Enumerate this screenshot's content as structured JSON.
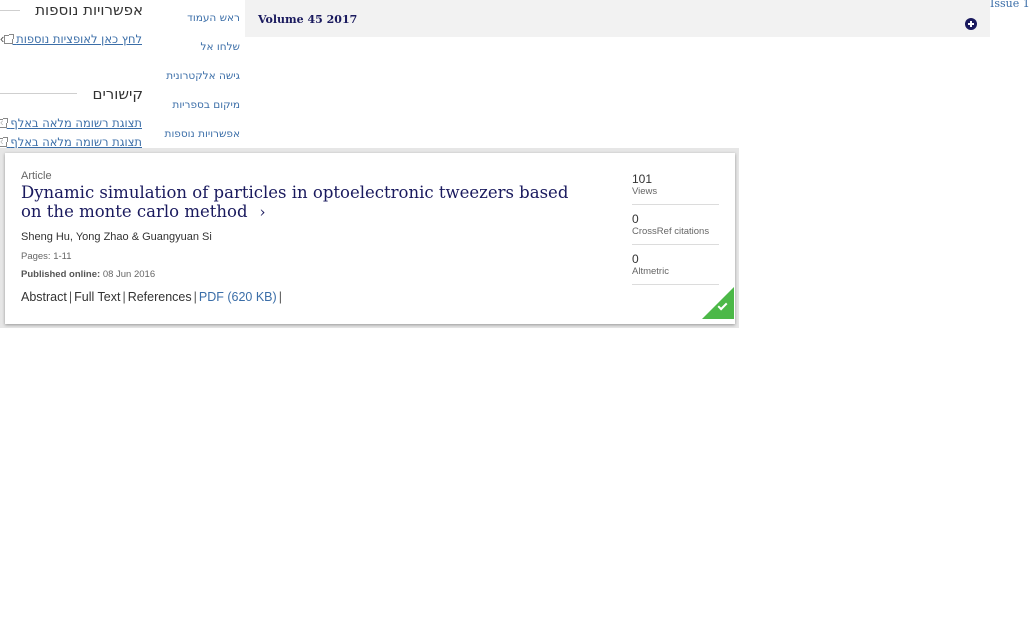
{
  "sidebar": {
    "options_heading": "אפשרויות נוספות",
    "options_link": "לחץ כאן לאופציות נוספות",
    "links_heading": "קישורים",
    "link_items": [
      "תצוגת רשומה מלאה באלף",
      "תצוגת רשומה מלאה באלף"
    ]
  },
  "nav": {
    "items": [
      "ראש העמוד",
      "שלחו אל",
      "גישה אלקטרונית",
      "מיקום בספריות",
      "אפשרויות נוספות"
    ]
  },
  "volume": {
    "title": "Volume 45 2017",
    "issue": "Issue 1",
    "expand_icon": "plus-circle-icon"
  },
  "article": {
    "type": "Article",
    "title": "Dynamic simulation of particles in optoelectronic tweezers based on the monte carlo method",
    "authors": "Sheng Hu, Yong Zhao & Guangyuan Si",
    "pages": "Pages: 1-11",
    "published_label": "Published online:",
    "published_date": "08 Jun 2016",
    "links": {
      "abstract": "Abstract",
      "full_text": "Full Text",
      "references": "References",
      "pdf": "PDF (620 KB)"
    },
    "metrics": [
      {
        "value": "101",
        "label": "Views"
      },
      {
        "value": "0",
        "label": "CrossRef citations"
      },
      {
        "value": "0",
        "label": "Altmetric"
      }
    ],
    "access_badge_icon": "checkmark-icon",
    "access_color": "#4cb848"
  },
  "colors": {
    "title_navy": "#1a1a5e",
    "link_blue": "#3b6ea8"
  }
}
